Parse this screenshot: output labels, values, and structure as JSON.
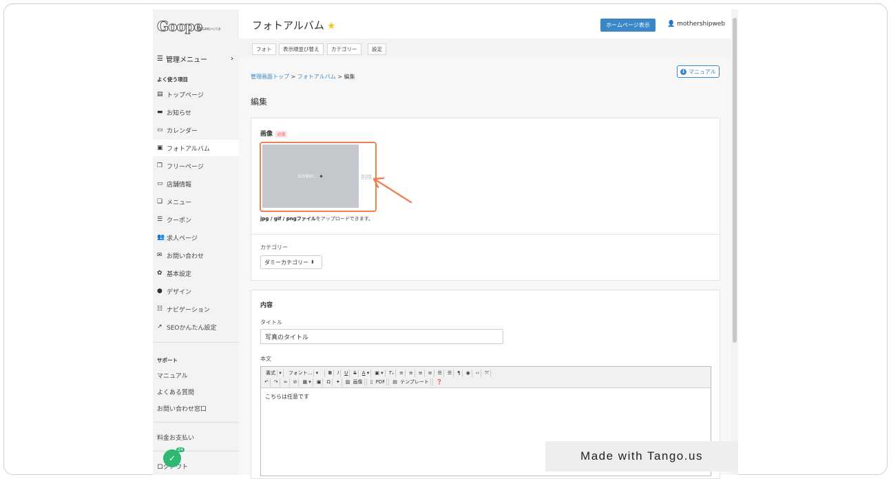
{
  "logo": {
    "text": "Goope",
    "sub": "by GMOペパボ"
  },
  "sidebar": {
    "menu_toggle": "管理メニュー",
    "section_frequent": "よく使う項目",
    "items": [
      {
        "label": "トップページ",
        "icon": "document-icon"
      },
      {
        "label": "お知らせ",
        "icon": "megaphone-icon"
      },
      {
        "label": "カレンダー",
        "icon": "calendar-icon"
      },
      {
        "label": "フォトアルバム",
        "icon": "photo-icon"
      },
      {
        "label": "フリーページ",
        "icon": "pages-icon"
      },
      {
        "label": "店舗情報",
        "icon": "store-icon"
      },
      {
        "label": "メニュー",
        "icon": "book-icon"
      },
      {
        "label": "クーポン",
        "icon": "coupon-icon"
      },
      {
        "label": "求人ページ",
        "icon": "people-icon"
      },
      {
        "label": "お問い合わせ",
        "icon": "mail-icon"
      },
      {
        "label": "基本設定",
        "icon": "gear-icon"
      },
      {
        "label": "デザイン",
        "icon": "palette-icon"
      },
      {
        "label": "ナビゲーション",
        "icon": "list-icon"
      },
      {
        "label": "SEOかんたん設定",
        "icon": "chart-icon"
      }
    ],
    "section_support": "サポート",
    "support_items": [
      "マニュアル",
      "よくある質問",
      "お問い合わせ窓口"
    ],
    "billing": "料金お支払い",
    "logout": "ログアウト"
  },
  "header": {
    "title": "フォトアルバム",
    "homepage_button": "ホームページ表示",
    "username": "mothershipweb"
  },
  "tabs": [
    "フォト",
    "表示順並び替え",
    "カテゴリー",
    "設定"
  ],
  "main": {
    "manual_button": "マニュアル",
    "breadcrumb": {
      "home": "管理画面トップ",
      "sep": ">",
      "album": "フォトアルバム",
      "current": "編集"
    },
    "heading": "編集",
    "image_section": {
      "label": "画像",
      "required": "必須",
      "thumb_text": "320900…",
      "delete": "削除",
      "note_bold": "jpg / gif / pngファイル",
      "note_rest": "をアップロードできます。"
    },
    "category": {
      "label": "カテゴリー",
      "value": "ダミーカテゴリー"
    },
    "content": {
      "heading": "内容",
      "title_label": "タイトル",
      "title_value": "写真のタイトル",
      "body_label": "本文",
      "body_text": "こちらは任意です"
    },
    "toolbar": {
      "format": "書式",
      "font": "フォント...",
      "image": "画像",
      "pdf": "PDF",
      "template": "テンプレート"
    }
  },
  "overlay": {
    "watermark": "Made with Tango.us",
    "badge_count": "24"
  },
  "colors": {
    "accent": "#3a87c8",
    "highlight": "#f08050",
    "success": "#2eb872",
    "star": "#f5c518"
  }
}
